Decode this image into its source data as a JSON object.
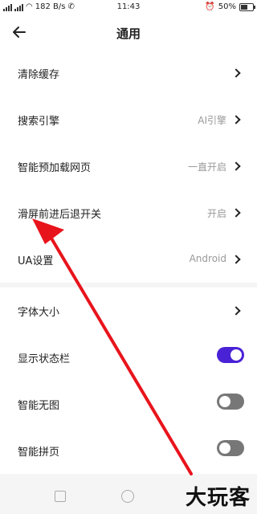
{
  "status_bar": {
    "network_speed": "182 B/s",
    "time": "11:43",
    "battery": "50%",
    "battery_level": 0.5
  },
  "header": {
    "title": "通用"
  },
  "settings_group1": [
    {
      "label": "清除缓存",
      "value": ""
    },
    {
      "label": "搜索引擎",
      "value": "AI引擎"
    },
    {
      "label": "智能预加载网页",
      "value": "一直开启"
    },
    {
      "label": "滑屏前进后退开关",
      "value": "开启"
    },
    {
      "label": "UA设置",
      "value": "Android"
    }
  ],
  "settings_group2": {
    "font_size": {
      "label": "字体大小"
    },
    "show_status_bar": {
      "label": "显示状态栏",
      "on": true
    },
    "smart_no_image": {
      "label": "智能无图",
      "on": false
    },
    "smart_page_join": {
      "label": "智能拼页",
      "on": false
    }
  },
  "colors": {
    "toggle_on": "#4a22d6",
    "toggle_off": "#777777",
    "annotation_arrow": "#e8141c"
  },
  "watermark": "大玩客"
}
